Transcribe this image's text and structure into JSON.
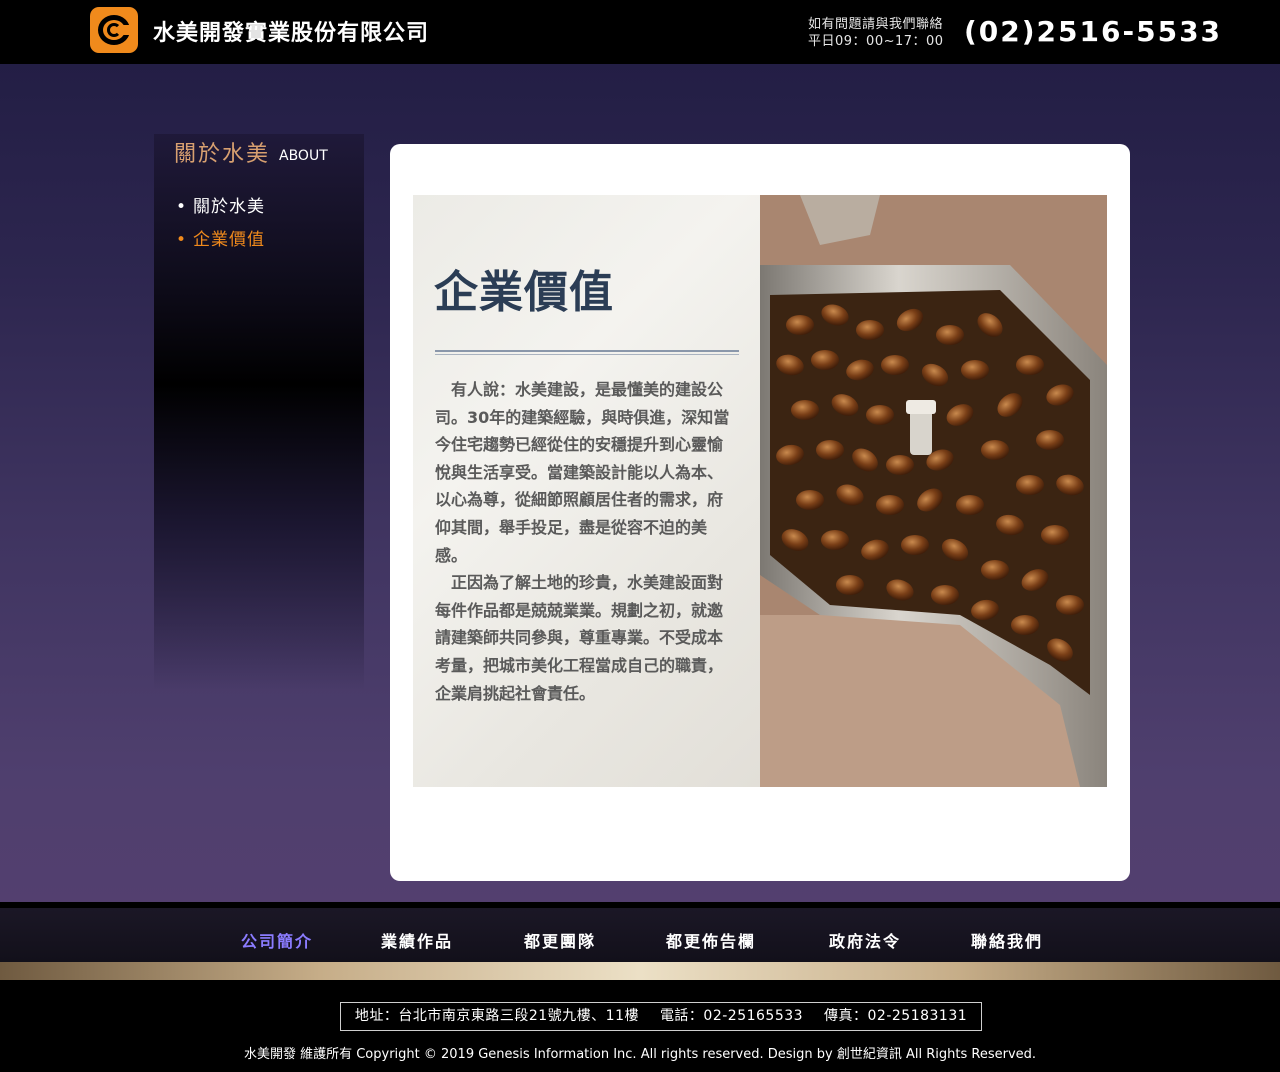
{
  "header": {
    "company_name": "水美開發實業股份有限公司",
    "contact_line1": "如有問題請與我們聯絡",
    "contact_line2": "平日09：00~17：00",
    "phone": "(02)2516-5533"
  },
  "sidebar": {
    "title": "關於水美",
    "title_en": "ABOUT",
    "items": [
      {
        "label": "關於水美",
        "active": false
      },
      {
        "label": "企業價值",
        "active": true
      }
    ]
  },
  "content": {
    "title": "企業價值",
    "paragraph1": "有人說：水美建設，是最懂美的建設公司。30年的建築經驗，與時俱進，深知當今住宅趨勢已經從住的安穩提升到心靈愉悅與生活享受。當建築設計能以人為本、以心為尊，從細節照顧居住者的需求，府仰其間，舉手投足，盡是從容不迫的美感。",
    "paragraph2": "正因為了解土地的珍貴，水美建設面對每件作品都是兢兢業業。規劃之初，就邀請建築師共同參與，尊重專業。不受成本考量，把城市美化工程當成自己的職責，企業肩挑起社會責任。"
  },
  "nav": {
    "items": [
      {
        "label": "公司簡介",
        "active": true
      },
      {
        "label": "業績作品",
        "active": false
      },
      {
        "label": "都更團隊",
        "active": false
      },
      {
        "label": "都更佈告欄",
        "active": false
      },
      {
        "label": "政府法令",
        "active": false
      },
      {
        "label": "聯絡我們",
        "active": false
      }
    ]
  },
  "footer": {
    "address": "地址：台北市南京東路三段21號九樓、11樓",
    "tel": "電話：02-25165533",
    "fax": "傳真：02-25183131",
    "copyright": "水美開發  維護所有 Copyright © 2019   Genesis Information Inc. All rights reserved. Design by 創世紀資訊 All Rights Reserved."
  },
  "colors": {
    "accent_orange": "#f08a1c",
    "active_nav": "#8b7cff",
    "title_navy": "#2b3d55"
  },
  "icons": {
    "logo": "company-logo-c",
    "photo": "coffee-grinder-beans-photo"
  }
}
